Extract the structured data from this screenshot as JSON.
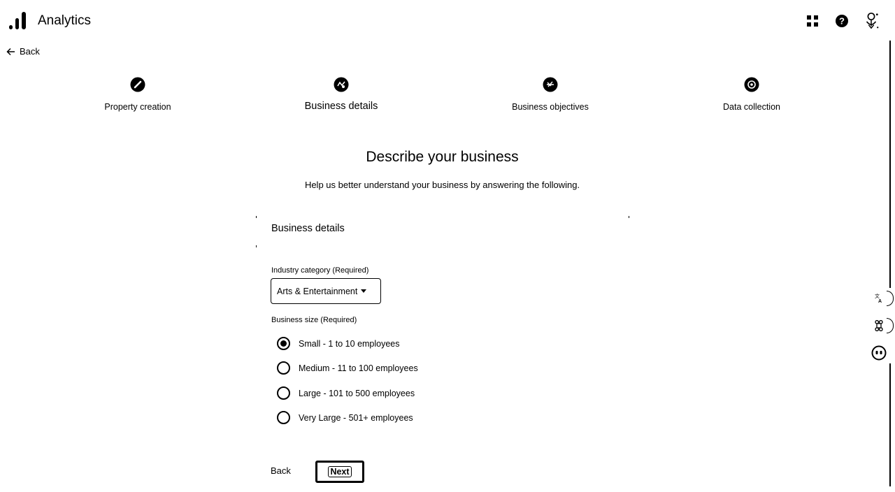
{
  "header": {
    "app_title": "Analytics",
    "icons": [
      "analytics-logo-icon",
      "apps-grid-icon",
      "help-icon",
      "account-avatar-icon"
    ]
  },
  "nav": {
    "back_label": "Back"
  },
  "stepper": {
    "steps": [
      {
        "label": "Property creation",
        "state": "complete"
      },
      {
        "label": "Business details",
        "state": "active"
      },
      {
        "label": "Business objectives",
        "state": "upcoming"
      },
      {
        "label": "Data collection",
        "state": "upcoming"
      }
    ]
  },
  "page": {
    "title": "Describe your business",
    "subtitle": "Help us better understand your business by answering the following."
  },
  "form": {
    "section_title": "Business details",
    "industry": {
      "label": "Industry category (Required)",
      "value": "Arts & Entertainment"
    },
    "size": {
      "label": "Business size (Required)",
      "selected_index": 0,
      "options": [
        "Small - 1 to 10 employees",
        "Medium - 11 to 100 employees",
        "Large - 101 to 500 employees",
        "Very Large - 501+ employees"
      ]
    },
    "back_label": "Back",
    "next_label": "Next"
  },
  "side_panel": {
    "icons": [
      "translate-icon",
      "command-icon",
      "face-icon"
    ]
  }
}
